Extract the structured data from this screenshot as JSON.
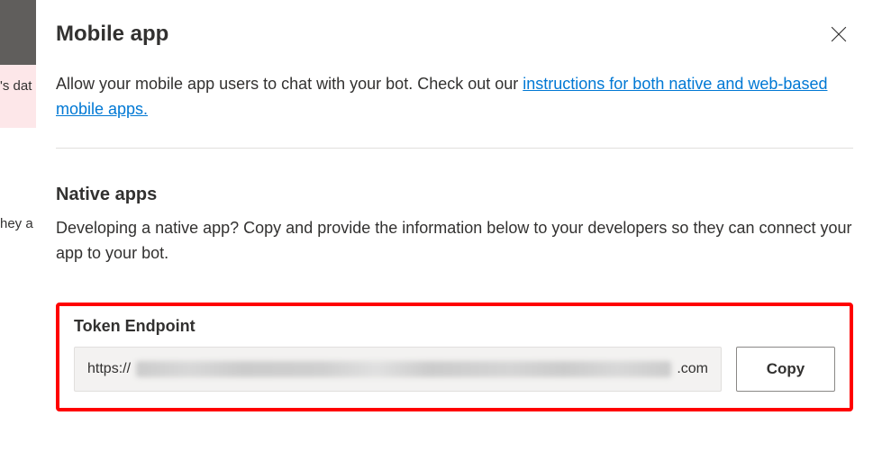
{
  "bg": {
    "text1": "'s dat",
    "text2": "hey a"
  },
  "panel": {
    "title": "Mobile app",
    "intro_prefix": "Allow your mobile app users to chat with your bot. Check out our ",
    "intro_link": "instructions for both native and web-based mobile apps."
  },
  "native": {
    "title": "Native apps",
    "desc": "Developing a native app? Copy and provide the information below to your developers so they can connect your app to your bot."
  },
  "token": {
    "label": "Token Endpoint",
    "prefix": "https://",
    "suffix": ".com",
    "copy_label": "Copy"
  }
}
